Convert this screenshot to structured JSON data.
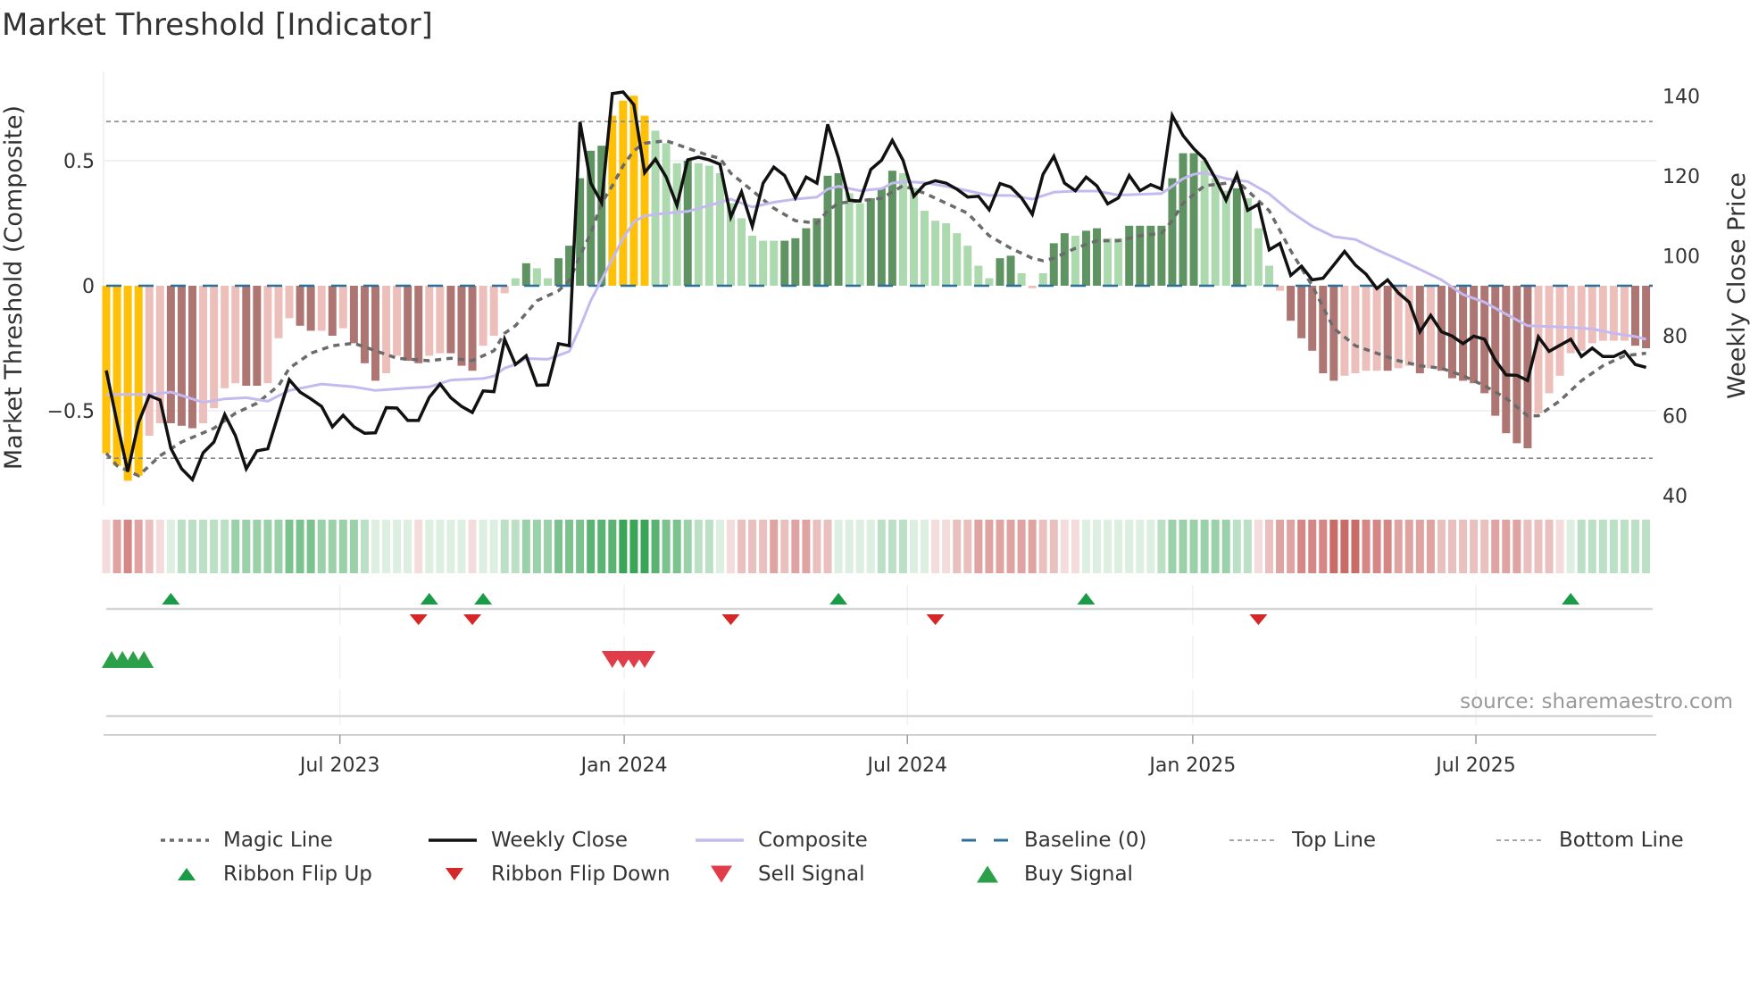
{
  "title": "Market Threshold [Indicator]",
  "source": "source: sharemaestro.com",
  "colors": {
    "yellow": "#FFC107",
    "pos_dark": "#5f9462",
    "pos_light": "#acd9ae",
    "neg_dark": "#ad7673",
    "neg_light": "#ecbfbb",
    "close": "#111111",
    "composite": "#c4baf0",
    "magic": "#6b6b6b",
    "baseline": "#2b6f9e",
    "flip_up": "#1a9c47",
    "flip_down": "#d62728",
    "buy": "#2ca048",
    "sell": "#e03c4a"
  },
  "legend": [
    {
      "label": "Magic Line",
      "icon": "dotted-line"
    },
    {
      "label": "Weekly Close",
      "icon": "solid-line"
    },
    {
      "label": "Composite",
      "icon": "lavender-line"
    },
    {
      "label": "Baseline (0)",
      "icon": "dashed-blue-line"
    },
    {
      "label": "Top Line",
      "icon": "dashed-gray-line"
    },
    {
      "label": "Bottom Line",
      "icon": "dashed-gray-line"
    },
    {
      "label": "Ribbon Flip Up",
      "icon": "triangle-up"
    },
    {
      "label": "Ribbon Flip Down",
      "icon": "triangle-down"
    },
    {
      "label": "Sell Signal",
      "icon": "triangle-down"
    },
    {
      "label": "Buy Signal",
      "icon": "triangle-up"
    }
  ],
  "chart_data": {
    "type": "bar",
    "title": "Market Threshold [Indicator]",
    "ylabel": "Market Threshold (Composite)",
    "y2label": "Weekly Close Price",
    "ylim": [
      -0.87,
      0.85
    ],
    "y2lim": [
      37,
      143
    ],
    "yticks": [
      {
        "v": 0.5,
        "label": "0.5"
      },
      {
        "v": 0,
        "label": "0"
      },
      {
        "v": -0.5,
        "label": "−0.5"
      }
    ],
    "y2ticks": [
      {
        "v": 140,
        "label": "140"
      },
      {
        "v": 120,
        "label": "120"
      },
      {
        "v": 100,
        "label": "100"
      },
      {
        "v": 80,
        "label": "80"
      },
      {
        "v": 60,
        "label": "60"
      },
      {
        "v": 40,
        "label": "40"
      }
    ],
    "xticks": [
      {
        "week": 21.7,
        "label": "Jul 2023"
      },
      {
        "week": 48.1,
        "label": "Jan 2024"
      },
      {
        "week": 74.4,
        "label": "Jul 2024"
      },
      {
        "week": 100.9,
        "label": "Jan 2025"
      },
      {
        "week": 127.2,
        "label": "Jul 2025"
      }
    ],
    "grid": true,
    "legend_position": "bottom",
    "top_line": 0.657,
    "bottom_line": -0.69,
    "baseline": 0,
    "composite_bars": [
      -0.67,
      -0.72,
      -0.78,
      -0.76,
      -0.6,
      -0.55,
      -0.55,
      -0.56,
      -0.57,
      -0.55,
      -0.49,
      -0.41,
      -0.39,
      -0.4,
      -0.4,
      -0.39,
      -0.21,
      -0.13,
      -0.16,
      -0.18,
      -0.18,
      -0.2,
      -0.17,
      -0.23,
      -0.31,
      -0.38,
      -0.35,
      -0.28,
      -0.3,
      -0.31,
      -0.28,
      -0.27,
      -0.27,
      -0.32,
      -0.34,
      -0.24,
      -0.2,
      -0.03,
      0.03,
      0.09,
      0.07,
      0.03,
      0.11,
      0.16,
      0.43,
      0.54,
      0.56,
      0.68,
      0.74,
      0.76,
      0.68,
      0.62,
      0.57,
      0.49,
      0.5,
      0.49,
      0.48,
      0.45,
      0.33,
      0.27,
      0.2,
      0.18,
      0.18,
      0.18,
      0.19,
      0.23,
      0.27,
      0.44,
      0.45,
      0.37,
      0.33,
      0.35,
      0.39,
      0.46,
      0.45,
      0.39,
      0.3,
      0.26,
      0.25,
      0.21,
      0.16,
      0.08,
      0.03,
      0.11,
      0.12,
      0.05,
      -0.01,
      0.05,
      0.17,
      0.21,
      0.2,
      0.22,
      0.23,
      0.19,
      0.19,
      0.24,
      0.24,
      0.24,
      0.24,
      0.43,
      0.53,
      0.53,
      0.5,
      0.43,
      0.38,
      0.39,
      0.35,
      0.23,
      0.08,
      -0.02,
      -0.14,
      -0.21,
      -0.26,
      -0.35,
      -0.38,
      -0.36,
      -0.35,
      -0.34,
      -0.34,
      -0.34,
      -0.33,
      -0.32,
      -0.35,
      -0.33,
      -0.34,
      -0.37,
      -0.38,
      -0.39,
      -0.43,
      -0.52,
      -0.59,
      -0.63,
      -0.65,
      -0.51,
      -0.43,
      -0.36,
      -0.27,
      -0.26,
      -0.23,
      -0.22,
      -0.22,
      -0.22,
      -0.24,
      -0.25
    ],
    "bar_kinds": "YYYYLLDDDLLLLDDLLLDDLDLDDDLLDDLLDDDLLLLDLLDDDDDYYYYLLLDLLLLLLLLDDDDDDLLDDDLLLLLLLLLDDLLLDDLDDLLDDDDDDDLLLDLLLLDDDDDLLLLDLLDLDDDDDDDDDLLLLLLLLLDD",
    "weekly_close": [
      71.3,
      58.3,
      46,
      58.3,
      65,
      63.9,
      51.8,
      46.7,
      44,
      50.7,
      53.4,
      60.3,
      55,
      46.7,
      51.2,
      51.7,
      60.5,
      69,
      65.9,
      64.2,
      62.3,
      57.2,
      60.1,
      57.2,
      55.6,
      55.7,
      62,
      61.9,
      58.8,
      58.8,
      64.6,
      67.9,
      64.5,
      62.3,
      60.8,
      66.2,
      66,
      79.1,
      72.8,
      75,
      67.6,
      67.7,
      78,
      77.5,
      133.5,
      118.2,
      113.3,
      140.6,
      141,
      137.8,
      120.8,
      124.2,
      119.7,
      112.6,
      124,
      124.7,
      124,
      122.9,
      109.7,
      116,
      107.4,
      118.2,
      122.2,
      120.1,
      114.5,
      119.7,
      118.2,
      132.9,
      124.5,
      113.9,
      113.7,
      121.6,
      123.9,
      128.9,
      123.9,
      114.9,
      117.9,
      118.8,
      118.2,
      116.7,
      114.7,
      114.9,
      111.5,
      118.1,
      117.2,
      114.5,
      110.4,
      120.4,
      124.9,
      118.2,
      116.3,
      119.7,
      117.5,
      113,
      114.5,
      120.1,
      116.3,
      117.8,
      116.7,
      135.1,
      130.1,
      126.8,
      124.2,
      119.4,
      113.9,
      120.4,
      111.4,
      112.9,
      101.5,
      103.1,
      95.1,
      97.4,
      94,
      94.4,
      97.7,
      101.1,
      97.7,
      95.4,
      91.8,
      94,
      90.7,
      88.4,
      81,
      85.1,
      81,
      79.9,
      78,
      79.9,
      79.1,
      73.9,
      70.2,
      70.1,
      68.8,
      79.7,
      76.1,
      77.6,
      79.1,
      74.8,
      76.9,
      74.8,
      74.8,
      76.1,
      72.8,
      72.1
    ],
    "composite_line": [
      [
        0,
        65.3
      ],
      [
        4,
        65.3
      ],
      [
        6,
        65.9
      ],
      [
        9,
        63.3
      ],
      [
        11,
        64.2
      ],
      [
        13,
        64.5
      ],
      [
        15,
        63.6
      ],
      [
        17,
        66.3
      ],
      [
        20,
        67.9
      ],
      [
        23,
        67.2
      ],
      [
        25,
        66.3
      ],
      [
        28,
        66.9
      ],
      [
        30,
        67.2
      ],
      [
        32,
        68.9
      ],
      [
        35,
        69.3
      ],
      [
        36,
        69.9
      ],
      [
        37,
        71.9
      ],
      [
        38,
        72.8
      ],
      [
        39,
        74.3
      ],
      [
        41,
        74.1
      ],
      [
        43,
        76.1
      ],
      [
        44,
        82.1
      ],
      [
        45,
        88.8
      ],
      [
        46,
        94
      ],
      [
        47,
        99.2
      ],
      [
        48,
        104.4
      ],
      [
        49,
        108.5
      ],
      [
        50,
        110
      ],
      [
        52,
        110.7
      ],
      [
        54,
        111.1
      ],
      [
        56,
        112.6
      ],
      [
        58,
        114.2
      ],
      [
        60,
        112.2
      ],
      [
        62,
        113.4
      ],
      [
        64,
        114.2
      ],
      [
        66,
        114.7
      ],
      [
        67,
        116.7
      ],
      [
        68,
        117.4
      ],
      [
        70,
        116.3
      ],
      [
        72,
        116.8
      ],
      [
        73,
        118.2
      ],
      [
        74,
        118.6
      ],
      [
        76,
        118.3
      ],
      [
        78,
        117.4
      ],
      [
        80,
        116.3
      ],
      [
        82,
        115.1
      ],
      [
        84,
        115.1
      ],
      [
        86,
        114.2
      ],
      [
        88,
        115.9
      ],
      [
        90,
        116.2
      ],
      [
        92,
        116.2
      ],
      [
        94,
        115.2
      ],
      [
        96,
        115.4
      ],
      [
        98,
        115.6
      ],
      [
        99,
        117.4
      ],
      [
        100,
        119.3
      ],
      [
        101,
        120.4
      ],
      [
        102,
        120.8
      ],
      [
        104,
        119.3
      ],
      [
        106,
        118.6
      ],
      [
        108,
        115.5
      ],
      [
        110,
        111
      ],
      [
        112,
        107.4
      ],
      [
        114,
        104.8
      ],
      [
        116,
        104.1
      ],
      [
        118,
        101.5
      ],
      [
        120,
        99.1
      ],
      [
        122,
        96.6
      ],
      [
        124,
        94
      ],
      [
        126,
        90.3
      ],
      [
        128,
        88.4
      ],
      [
        130,
        85.4
      ],
      [
        132,
        82.5
      ],
      [
        134,
        82.3
      ],
      [
        136,
        82.1
      ],
      [
        138,
        81.7
      ],
      [
        140,
        80.6
      ],
      [
        142,
        79.8
      ],
      [
        143,
        79.1
      ]
    ],
    "magic_line": [
      [
        0,
        -0.67
      ],
      [
        1,
        -0.72
      ],
      [
        3,
        -0.76
      ],
      [
        5,
        -0.68
      ],
      [
        7,
        -0.625
      ],
      [
        10,
        -0.57
      ],
      [
        12,
        -0.51
      ],
      [
        14,
        -0.47
      ],
      [
        16,
        -0.4
      ],
      [
        17,
        -0.33
      ],
      [
        19,
        -0.27
      ],
      [
        21,
        -0.24
      ],
      [
        23,
        -0.23
      ],
      [
        25,
        -0.26
      ],
      [
        27,
        -0.29
      ],
      [
        30,
        -0.3
      ],
      [
        32,
        -0.29
      ],
      [
        34,
        -0.3
      ],
      [
        36,
        -0.26
      ],
      [
        37,
        -0.19
      ],
      [
        38,
        -0.16
      ],
      [
        40,
        -0.06
      ],
      [
        42,
        -0.02
      ],
      [
        43,
        0.02
      ],
      [
        44,
        0.12
      ],
      [
        45,
        0.21
      ],
      [
        46,
        0.33
      ],
      [
        47,
        0.4
      ],
      [
        48,
        0.48
      ],
      [
        49,
        0.54
      ],
      [
        50,
        0.57
      ],
      [
        52,
        0.58
      ],
      [
        54,
        0.55
      ],
      [
        56,
        0.52
      ],
      [
        57,
        0.51
      ],
      [
        58,
        0.45
      ],
      [
        60,
        0.38
      ],
      [
        62,
        0.31
      ],
      [
        64,
        0.26
      ],
      [
        66,
        0.25
      ],
      [
        67,
        0.3
      ],
      [
        68,
        0.33
      ],
      [
        70,
        0.34
      ],
      [
        72,
        0.35
      ],
      [
        74,
        0.4
      ],
      [
        76,
        0.37
      ],
      [
        78,
        0.33
      ],
      [
        80,
        0.29
      ],
      [
        82,
        0.2
      ],
      [
        84,
        0.15
      ],
      [
        86,
        0.11
      ],
      [
        87,
        0.1
      ],
      [
        88,
        0.11
      ],
      [
        90,
        0.15
      ],
      [
        92,
        0.18
      ],
      [
        94,
        0.18
      ],
      [
        96,
        0.2
      ],
      [
        98,
        0.21
      ],
      [
        99,
        0.26
      ],
      [
        100,
        0.33
      ],
      [
        102,
        0.4
      ],
      [
        104,
        0.41
      ],
      [
        105,
        0.42
      ],
      [
        106,
        0.38
      ],
      [
        108,
        0.3
      ],
      [
        110,
        0.14
      ],
      [
        112,
        0.0
      ],
      [
        114,
        -0.17
      ],
      [
        116,
        -0.24
      ],
      [
        118,
        -0.27
      ],
      [
        120,
        -0.3
      ],
      [
        122,
        -0.32
      ],
      [
        124,
        -0.33
      ],
      [
        126,
        -0.36
      ],
      [
        128,
        -0.4
      ],
      [
        130,
        -0.45
      ],
      [
        132,
        -0.52
      ],
      [
        133,
        -0.52
      ],
      [
        135,
        -0.46
      ],
      [
        137,
        -0.38
      ],
      [
        139,
        -0.32
      ],
      [
        141,
        -0.28
      ],
      [
        143,
        -0.27
      ]
    ],
    "ribbon_levels": [
      -1,
      -3,
      -4,
      -3,
      -2,
      -1,
      1,
      2,
      2,
      2,
      2,
      2,
      3,
      3,
      3,
      3,
      3,
      4,
      4,
      4,
      3,
      3,
      3,
      3,
      2,
      1,
      1,
      1,
      1,
      -1,
      1,
      1,
      1,
      1,
      -1,
      1,
      1,
      2,
      2,
      3,
      3,
      3,
      4,
      4,
      4,
      5,
      5,
      5,
      6,
      6,
      6,
      5,
      4,
      4,
      3,
      2,
      2,
      1,
      -1,
      -2,
      -2,
      -2,
      -3,
      -2,
      -3,
      -3,
      -2,
      -2,
      1,
      1,
      1,
      1,
      2,
      2,
      2,
      1,
      1,
      -1,
      -1,
      -2,
      -2,
      -3,
      -3,
      -3,
      -3,
      -3,
      -3,
      -2,
      -2,
      -1,
      -1,
      1,
      1,
      1,
      1,
      1,
      1,
      1,
      2,
      3,
      3,
      3,
      3,
      3,
      3,
      2,
      2,
      -1,
      -2,
      -3,
      -3,
      -4,
      -4,
      -4,
      -5,
      -5,
      -5,
      -4,
      -4,
      -4,
      -3,
      -3,
      -3,
      -3,
      -2,
      -2,
      -2,
      -2,
      -2,
      -3,
      -3,
      -3,
      -2,
      -2,
      -2,
      -1,
      1,
      2,
      2,
      2,
      2,
      2,
      2,
      2
    ],
    "ribbon_flip_up_weeks": [
      6,
      30,
      35,
      68,
      91,
      136
    ],
    "ribbon_flip_down_weeks": [
      29,
      34,
      58,
      77,
      107
    ],
    "buy_signal_weeks": [
      0,
      1,
      2,
      3
    ],
    "sell_signal_weeks": [
      47,
      48,
      49,
      50
    ]
  }
}
